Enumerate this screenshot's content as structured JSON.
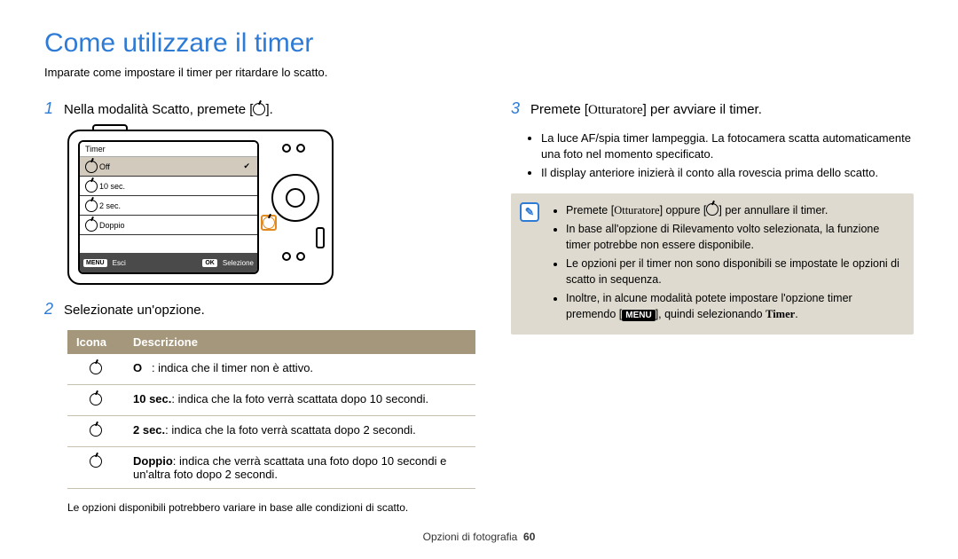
{
  "title": "Come utilizzare il timer",
  "subtitle": "Imparate come impostare il timer per ritardare lo scatto.",
  "step1": {
    "num": "1",
    "text_before": "Nella modalità Scatto, premete [",
    "text_after": "]."
  },
  "camera": {
    "lcd_title": "Timer",
    "rows": [
      {
        "label": "Off",
        "active": true
      },
      {
        "label": "10 sec.",
        "active": false
      },
      {
        "label": "2 sec.",
        "active": false
      },
      {
        "label": "Doppio",
        "active": false
      }
    ],
    "footer_menu_tag": "MENU",
    "footer_menu_label": "Esci",
    "footer_ok_tag": "OK",
    "footer_ok_label": "Selezione"
  },
  "step2": {
    "num": "2",
    "text": "Selezionate un'opzione."
  },
  "table": {
    "head_icon": "Icona",
    "head_desc": "Descrizione",
    "rows": [
      {
        "strong": "O   ",
        "desc": ": indica che il timer non è attivo."
      },
      {
        "strong": "10 sec.",
        "desc": ": indica che la foto verrà scattata dopo 10 secondi."
      },
      {
        "strong": "2 sec.",
        "desc": ": indica che la foto verrà scattata dopo 2 secondi."
      },
      {
        "strong": "Doppio",
        "desc": ": indica che verrà scattata una foto dopo 10 secondi e un'altra foto dopo 2 secondi."
      }
    ]
  },
  "footnote": "Le opzioni disponibili potrebbero variare in base alle condizioni di scatto.",
  "step3": {
    "num": "3",
    "pre": "Premete [",
    "shutter": "Otturatore",
    "post": "] per avviare il timer.",
    "bullets": [
      "La luce AF/spia timer lampeggia. La fotocamera scatta automaticamente una foto nel momento specificato.",
      "Il display anteriore inizierà il conto alla rovescia prima dello scatto."
    ]
  },
  "note": {
    "items": {
      "i1_pre": "Premete [",
      "i1_shutter": "Otturatore",
      "i1_mid": "] oppure [",
      "i1_post": "] per annullare il timer.",
      "i2": "In base all'opzione di Rilevamento volto selezionata, la funzione timer potrebbe non essere disponibile.",
      "i3": "Le opzioni per il timer non sono disponibili se impostate le opzioni di scatto in sequenza.",
      "i4_pre": "Inoltre, in alcune modalità potete impostare l'opzione timer premendo [",
      "i4_menu": "MENU",
      "i4_post": "], quindi selezionando ",
      "i4_timer": "Timer",
      "i4_end": "."
    }
  },
  "page_footer": {
    "section": "Opzioni di fotografia",
    "page": "60"
  }
}
